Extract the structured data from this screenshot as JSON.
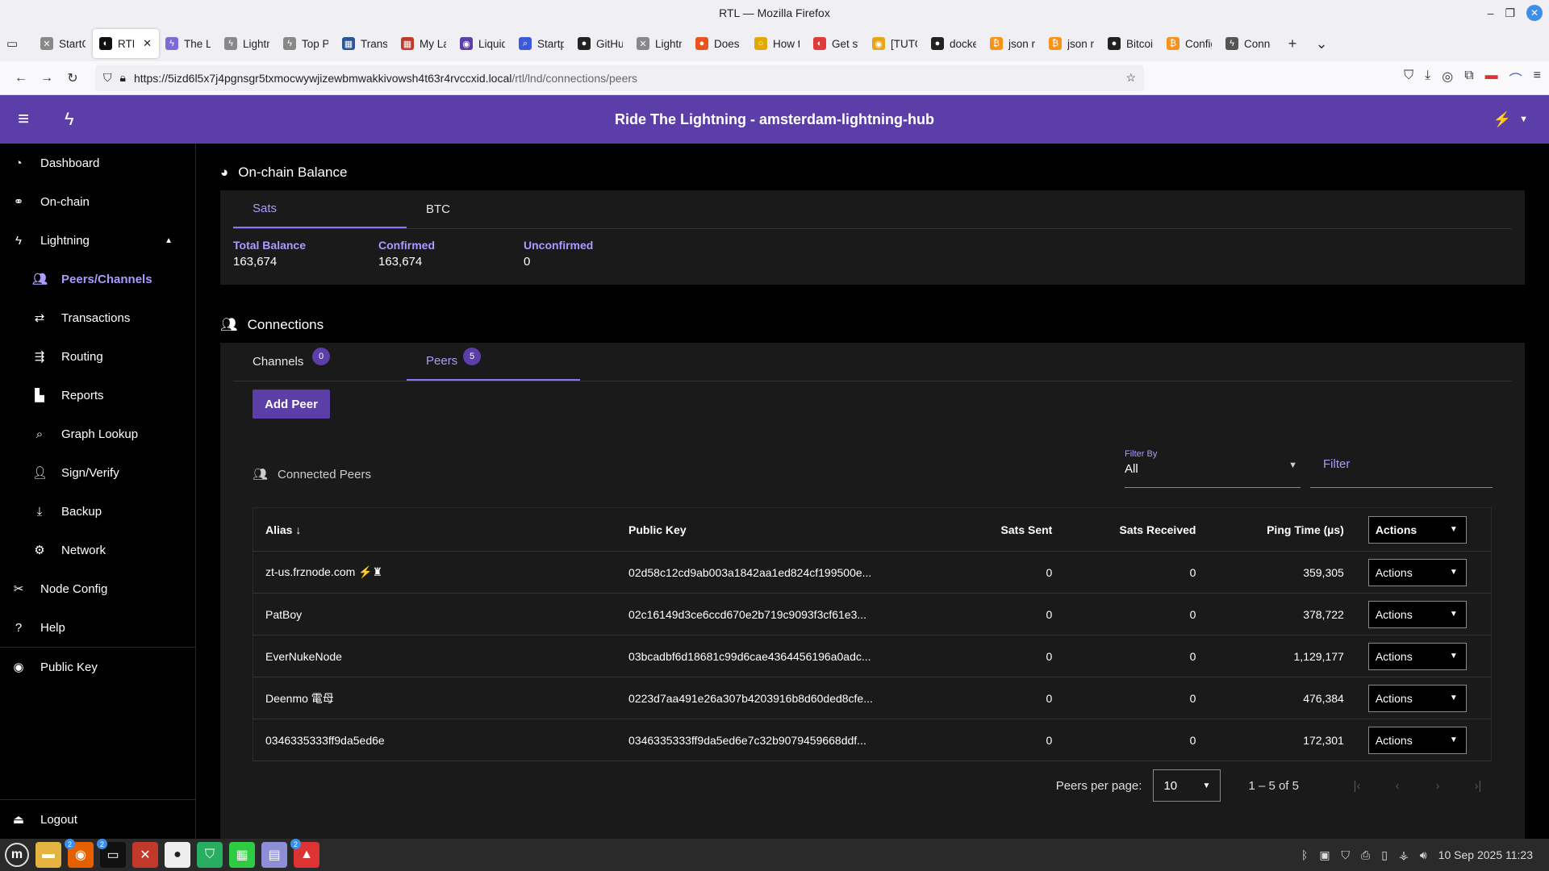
{
  "window": {
    "title": "RTL — Mozilla Firefox"
  },
  "browser": {
    "tabs": [
      {
        "label": "StartO",
        "color": "#888888",
        "glyph": "✕"
      },
      {
        "label": "RTL",
        "color": "#111111",
        "glyph": "◐",
        "active": true
      },
      {
        "label": "The Lo",
        "color": "#7a6bd6",
        "glyph": "ϟ"
      },
      {
        "label": "Lightni",
        "color": "#888888",
        "glyph": "ϟ"
      },
      {
        "label": "Top Pe",
        "color": "#888888",
        "glyph": "ϟ"
      },
      {
        "label": "Transa",
        "color": "#2b5797",
        "glyph": "▦"
      },
      {
        "label": "My Las",
        "color": "#c0392b",
        "glyph": "▦"
      },
      {
        "label": "Liquidi",
        "color": "#5c3ea8",
        "glyph": "◉"
      },
      {
        "label": "Startpa",
        "color": "#3b5bdb",
        "glyph": "⌕"
      },
      {
        "label": "GitHub",
        "color": "#222222",
        "glyph": "●"
      },
      {
        "label": "Lightni",
        "color": "#888888",
        "glyph": "✕"
      },
      {
        "label": "Does Li",
        "color": "#e8541e",
        "glyph": "●"
      },
      {
        "label": "How to",
        "color": "#e0a800",
        "glyph": "○"
      },
      {
        "label": "Get sta",
        "color": "#e03a3a",
        "glyph": "◐"
      },
      {
        "label": "[TUTO",
        "color": "#e8a317",
        "glyph": "◉"
      },
      {
        "label": "docker",
        "color": "#222222",
        "glyph": "●"
      },
      {
        "label": "json rp",
        "color": "#f7931a",
        "glyph": "₿"
      },
      {
        "label": "json rp",
        "color": "#f7931a",
        "glyph": "₿"
      },
      {
        "label": "Bitcoin",
        "color": "#222222",
        "glyph": "●"
      },
      {
        "label": "Config",
        "color": "#f7931a",
        "glyph": "₿"
      },
      {
        "label": "Conne",
        "color": "#555555",
        "glyph": "ϟ"
      }
    ],
    "url_host": "https://5izd6l5x7j4pgnsgr5txmocwywjizewbmwakkivowsh4t63r4rvccxid.local",
    "url_path": "/rtl/lnd/connections/peers"
  },
  "app": {
    "title": "Ride The Lightning - amsterdam-lightning-hub"
  },
  "sidebar": {
    "items": [
      {
        "label": "Dashboard",
        "icon": "dashboard-icon",
        "glyph": "◔"
      },
      {
        "label": "On-chain",
        "icon": "link-icon",
        "glyph": "⚭"
      },
      {
        "label": "Lightning",
        "icon": "bolt-icon",
        "glyph": "ϟ"
      },
      {
        "label": "Peers/Channels",
        "icon": "users-icon",
        "glyph": "👥"
      },
      {
        "label": "Transactions",
        "icon": "exchange-icon",
        "glyph": "⇄"
      },
      {
        "label": "Routing",
        "icon": "routing-icon",
        "glyph": "⇶"
      },
      {
        "label": "Reports",
        "icon": "chart-icon",
        "glyph": "▙"
      },
      {
        "label": "Graph Lookup",
        "icon": "search-icon",
        "glyph": "⌕"
      },
      {
        "label": "Sign/Verify",
        "icon": "user-check-icon",
        "glyph": "👤"
      },
      {
        "label": "Backup",
        "icon": "download-icon",
        "glyph": "⤓"
      },
      {
        "label": "Network",
        "icon": "network-icon",
        "glyph": "⚙"
      },
      {
        "label": "Node Config",
        "icon": "tools-icon",
        "glyph": "✂"
      },
      {
        "label": "Help",
        "icon": "help-icon",
        "glyph": "?"
      },
      {
        "label": "Public Key",
        "icon": "eye-icon",
        "glyph": "◉"
      },
      {
        "label": "Logout",
        "icon": "eject-icon",
        "glyph": "⏏"
      }
    ]
  },
  "balance": {
    "title": "On-chain Balance",
    "tabs": [
      "Sats",
      "BTC"
    ],
    "total_label": "Total Balance",
    "total_value": "163,674",
    "confirmed_label": "Confirmed",
    "confirmed_value": "163,674",
    "unconfirmed_label": "Unconfirmed",
    "unconfirmed_value": "0"
  },
  "connections": {
    "title": "Connections",
    "tab_channels": "Channels",
    "tab_channels_count": "0",
    "tab_peers": "Peers",
    "tab_peers_count": "5",
    "add_peer": "Add Peer",
    "connected_peers": "Connected Peers",
    "filter_by_label": "Filter By",
    "filter_by_value": "All",
    "filter_placeholder": "Filter"
  },
  "table": {
    "headers": {
      "alias": "Alias",
      "pubkey": "Public Key",
      "sent": "Sats Sent",
      "received": "Sats Received",
      "ping": "Ping Time (µs)",
      "actions": "Actions"
    },
    "rows": [
      {
        "alias": "zt-us.frznode.com ⚡♜",
        "pubkey": "02d58c12cd9ab003a1842aa1ed824cf199500e...",
        "sent": "0",
        "received": "0",
        "ping": "359,305",
        "action": "Actions"
      },
      {
        "alias": "PatBoy",
        "pubkey": "02c16149d3ce6ccd670e2b719c9093f3cf61e3...",
        "sent": "0",
        "received": "0",
        "ping": "378,722",
        "action": "Actions"
      },
      {
        "alias": "EverNukeNode",
        "pubkey": "03bcadbf6d18681c99d6cae4364456196a0adc...",
        "sent": "0",
        "received": "0",
        "ping": "1,129,177",
        "action": "Actions"
      },
      {
        "alias": "Deenmo 電母",
        "pubkey": "0223d7aa491e26a307b4203916b8d60ded8cfe...",
        "sent": "0",
        "received": "0",
        "ping": "476,384",
        "action": "Actions"
      },
      {
        "alias": "0346335333ff9da5ed6e",
        "pubkey": "0346335333ff9da5ed6e7c32b9079459668ddf...",
        "sent": "0",
        "received": "0",
        "ping": "172,301",
        "action": "Actions"
      }
    ]
  },
  "pager": {
    "per_page_label": "Peers per page:",
    "per_page_value": "10",
    "range": "1 – 5 of 5"
  },
  "taskbar": {
    "clock": "10 Sep 2025 11:23"
  }
}
